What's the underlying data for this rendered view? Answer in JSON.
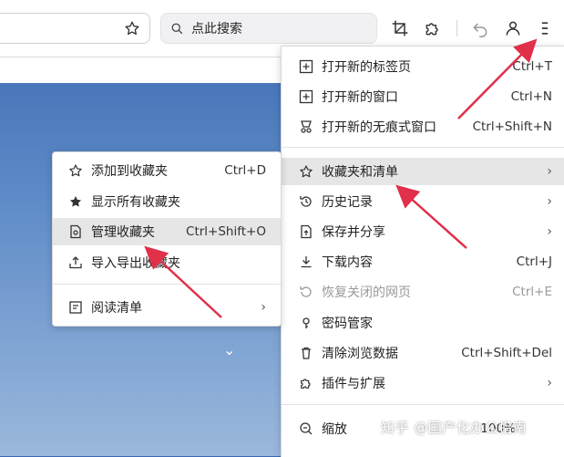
{
  "toolbar": {
    "search_placeholder": "点此搜索"
  },
  "main_menu": {
    "items": [
      {
        "label": "打开新的标签页",
        "shortcut": "Ctrl+T",
        "icon": "new-tab-icon"
      },
      {
        "label": "打开新的窗口",
        "shortcut": "Ctrl+N",
        "icon": "new-window-icon"
      },
      {
        "label": "打开新的无痕式窗口",
        "shortcut": "Ctrl+Shift+N",
        "icon": "incognito-icon"
      },
      {
        "label": "收藏夹和清单",
        "shortcut": "",
        "icon": "star-icon"
      },
      {
        "label": "历史记录",
        "shortcut": "",
        "icon": "history-icon"
      },
      {
        "label": "保存并分享",
        "shortcut": "",
        "icon": "save-share-icon"
      },
      {
        "label": "下载内容",
        "shortcut": "Ctrl+J",
        "icon": "download-icon"
      },
      {
        "label": "恢复关闭的网页",
        "shortcut": "Ctrl+E",
        "icon": "restore-icon"
      },
      {
        "label": "密码管家",
        "shortcut": "",
        "icon": "key-icon"
      },
      {
        "label": "清除浏览数据",
        "shortcut": "Ctrl+Shift+Del",
        "icon": "trash-icon"
      },
      {
        "label": "插件与扩展",
        "shortcut": "",
        "icon": "puzzle-icon"
      },
      {
        "label": "缩放",
        "shortcut": "100%",
        "icon": "zoom-icon"
      }
    ]
  },
  "sub_menu": {
    "items": [
      {
        "label": "添加到收藏夹",
        "shortcut": "Ctrl+D",
        "icon": "star-outline-icon"
      },
      {
        "label": "显示所有收藏夹",
        "shortcut": "",
        "icon": "star-sparkle-icon"
      },
      {
        "label": "管理收藏夹",
        "shortcut": "Ctrl+Shift+O",
        "icon": "manage-bookmarks-icon"
      },
      {
        "label": "导入导出收藏夹",
        "shortcut": "",
        "icon": "import-export-icon"
      },
      {
        "label": "阅读清单",
        "shortcut": "",
        "icon": "reading-list-icon"
      }
    ]
  },
  "page": {
    "watermark": "知乎 @国产化办公指南"
  },
  "colors": {
    "arrow": "#e0304a",
    "highlight": "#e6e6e6"
  }
}
